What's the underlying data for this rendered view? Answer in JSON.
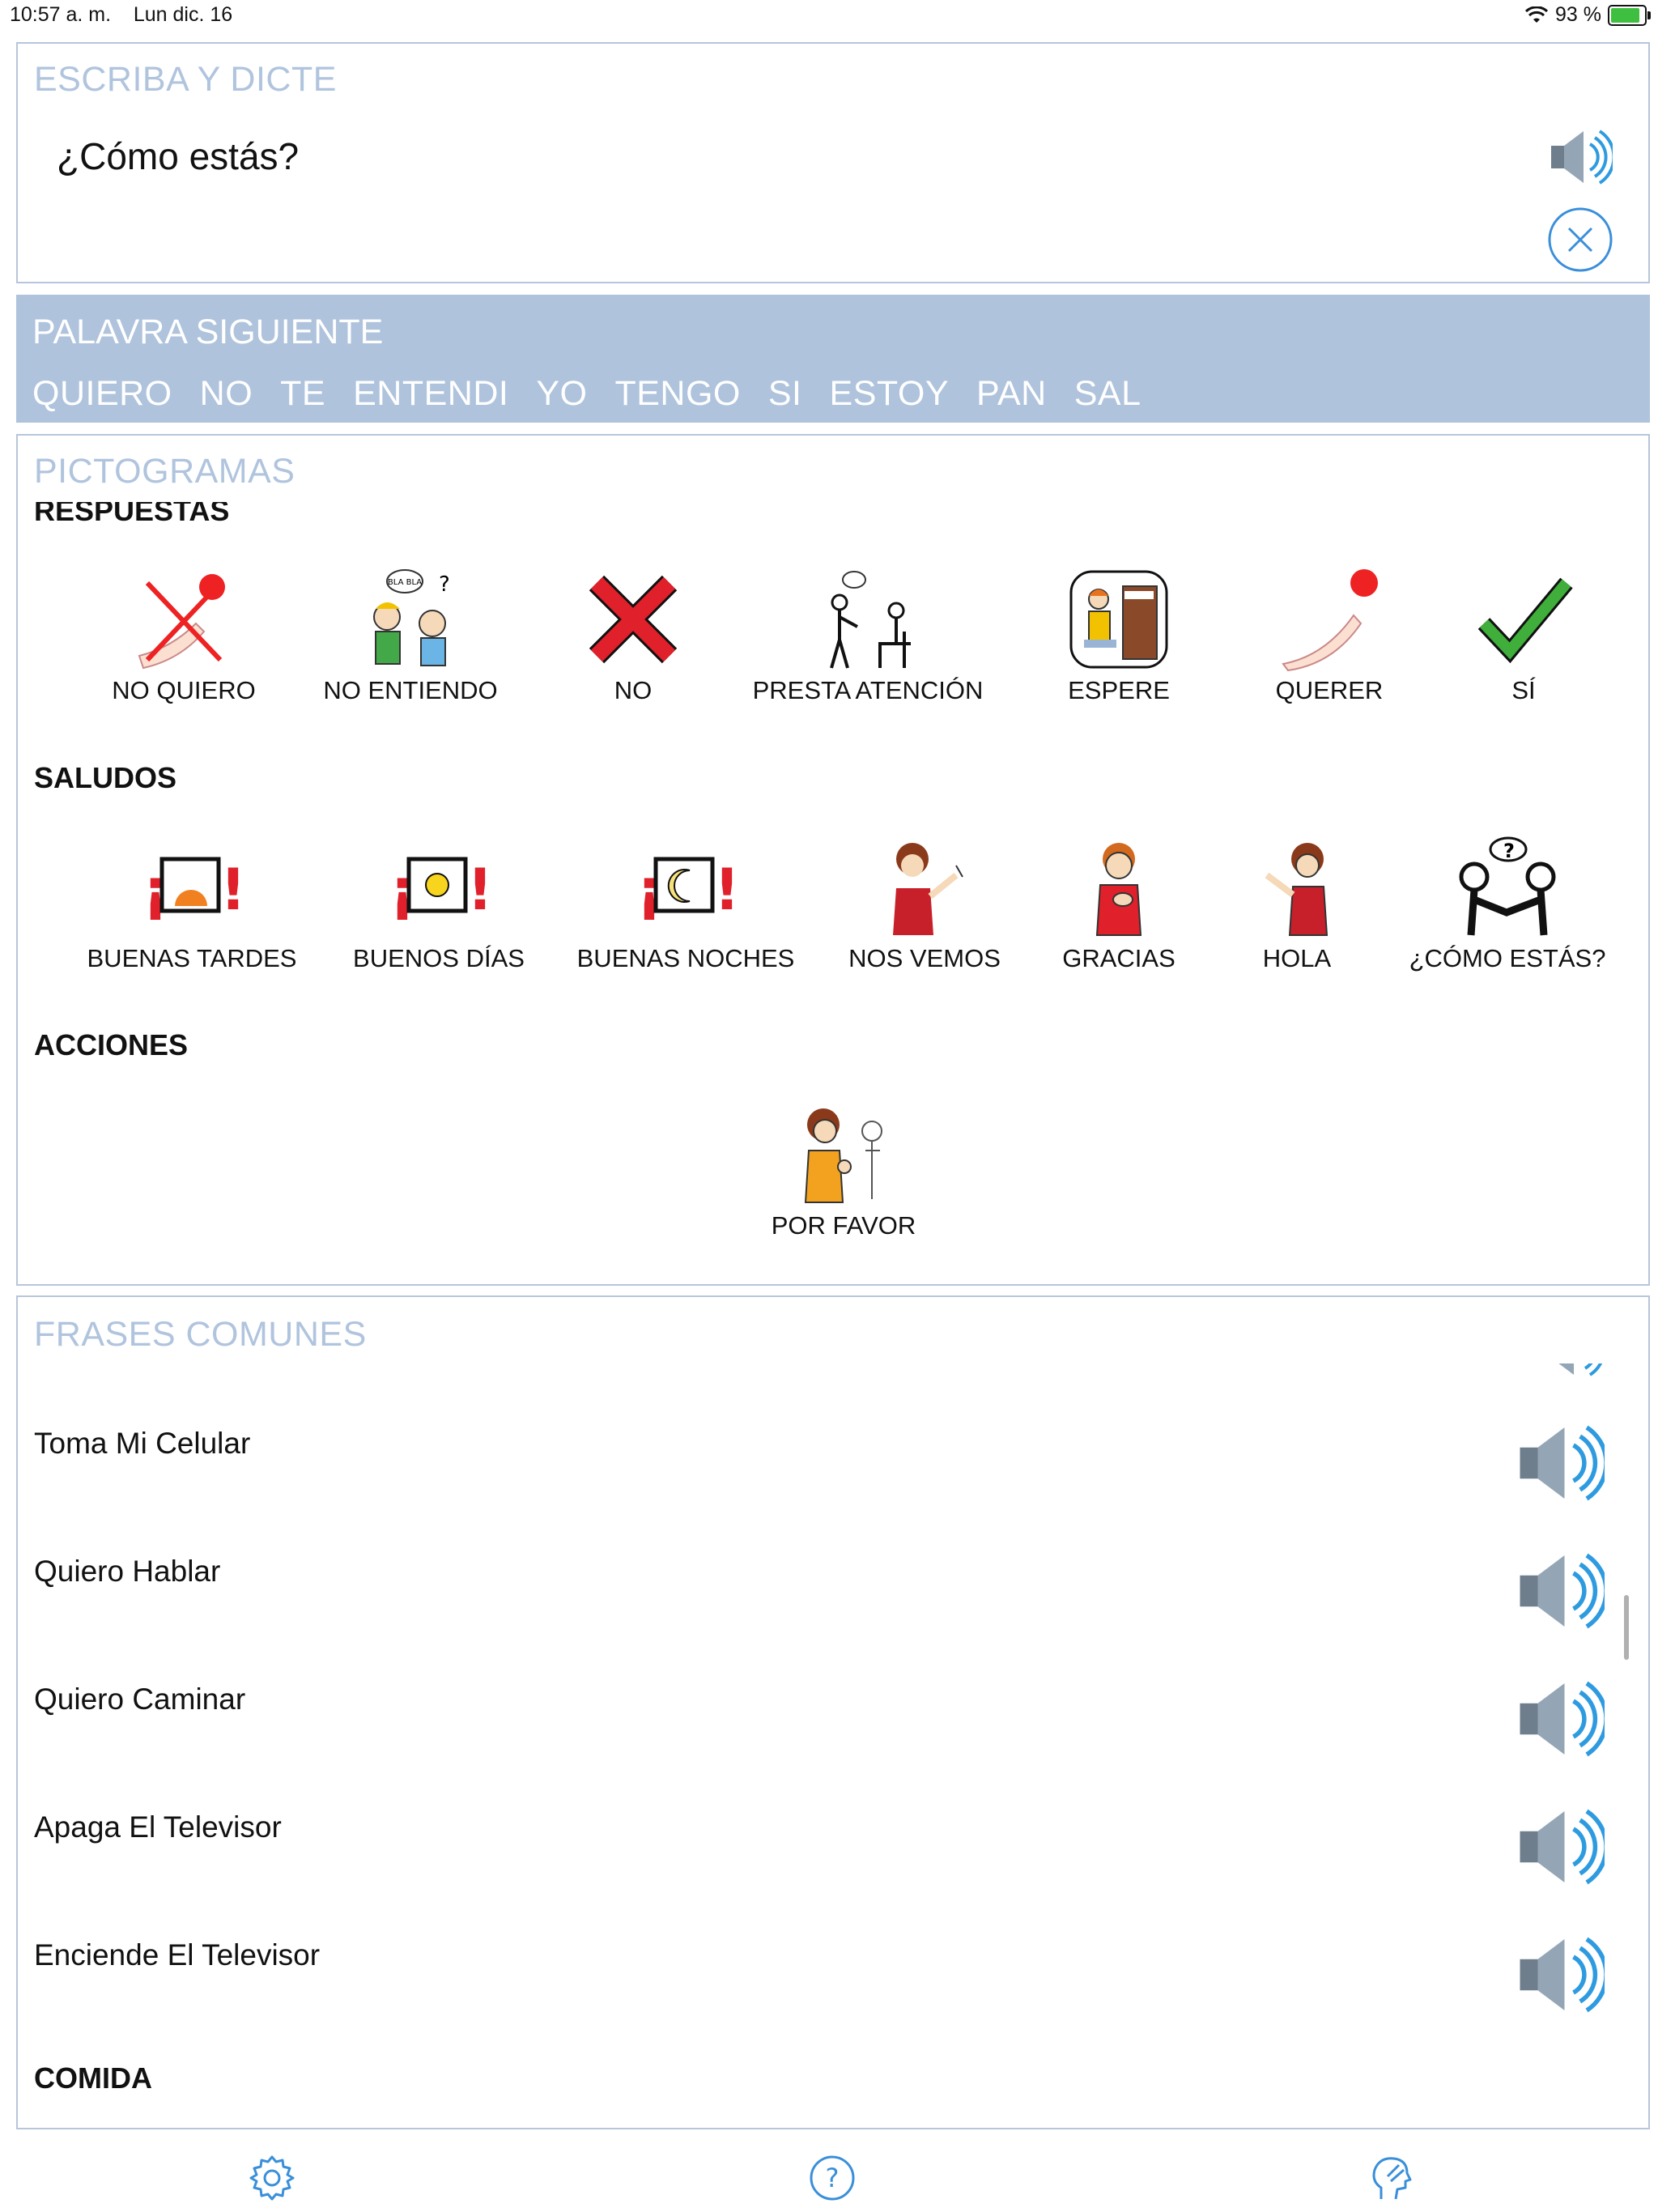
{
  "status_bar": {
    "time": "10:57 a. m.",
    "date": "Lun dic. 16",
    "battery_pct": "93 %"
  },
  "dictation": {
    "title": "ESCRIBA Y DICTE",
    "text": "¿Cómo estás?",
    "speak_icon": "speaker-icon",
    "clear_icon": "close-circle-icon"
  },
  "next_word": {
    "title": "PALAVRA SIGUIENTE",
    "words": [
      "QUIERO",
      "NO",
      "TE",
      "ENTENDI",
      "YO",
      "TENGO",
      "SI",
      "ESTOY",
      "PAN",
      "SAL"
    ]
  },
  "pictograms": {
    "title": "PICTOGRAMAS",
    "sections": [
      {
        "name": "RESPUESTAS",
        "items": [
          {
            "label": "NO QUIERO",
            "icon": "no-want-icon"
          },
          {
            "label": "NO ENTIENDO",
            "icon": "not-understand-icon"
          },
          {
            "label": "NO",
            "icon": "red-x-icon"
          },
          {
            "label": "PRESTA ATENCIÓN",
            "icon": "pay-attention-icon"
          },
          {
            "label": "ESPERE",
            "icon": "wait-icon"
          },
          {
            "label": "QUERER",
            "icon": "want-icon"
          },
          {
            "label": "SÍ",
            "icon": "checkmark-icon"
          }
        ]
      },
      {
        "name": "SALUDOS",
        "items": [
          {
            "label": "BUENAS TARDES",
            "icon": "sunset-icon"
          },
          {
            "label": "BUENOS DÍAS",
            "icon": "sun-icon"
          },
          {
            "label": "BUENAS NOCHES",
            "icon": "moon-icon"
          },
          {
            "label": "NOS VEMOS",
            "icon": "wave-goodbye-icon"
          },
          {
            "label": "GRACIAS",
            "icon": "thanks-icon"
          },
          {
            "label": "HOLA",
            "icon": "hello-icon"
          },
          {
            "label": "¿CÓMO ESTÁS?",
            "icon": "how-are-you-icon"
          }
        ]
      },
      {
        "name": "ACCIONES",
        "items": [
          {
            "label": "POR FAVOR",
            "icon": "please-icon"
          }
        ]
      }
    ]
  },
  "phrases": {
    "title": "FRASES COMUNES",
    "items": [
      "Toma Mi Celular",
      "Quiero Hablar",
      "Quiero Caminar",
      "Apaga El Televisor",
      "Enciende El Televisor"
    ],
    "next_section": "COMIDA"
  },
  "toolbar": {
    "settings_icon": "gear-icon",
    "help_icon": "help-icon",
    "speech_icon": "head-speech-icon"
  },
  "colors": {
    "accent": "#b0c4de",
    "word_bar_bg": "#afc3dc",
    "icon_blue": "#3a8fd9"
  }
}
